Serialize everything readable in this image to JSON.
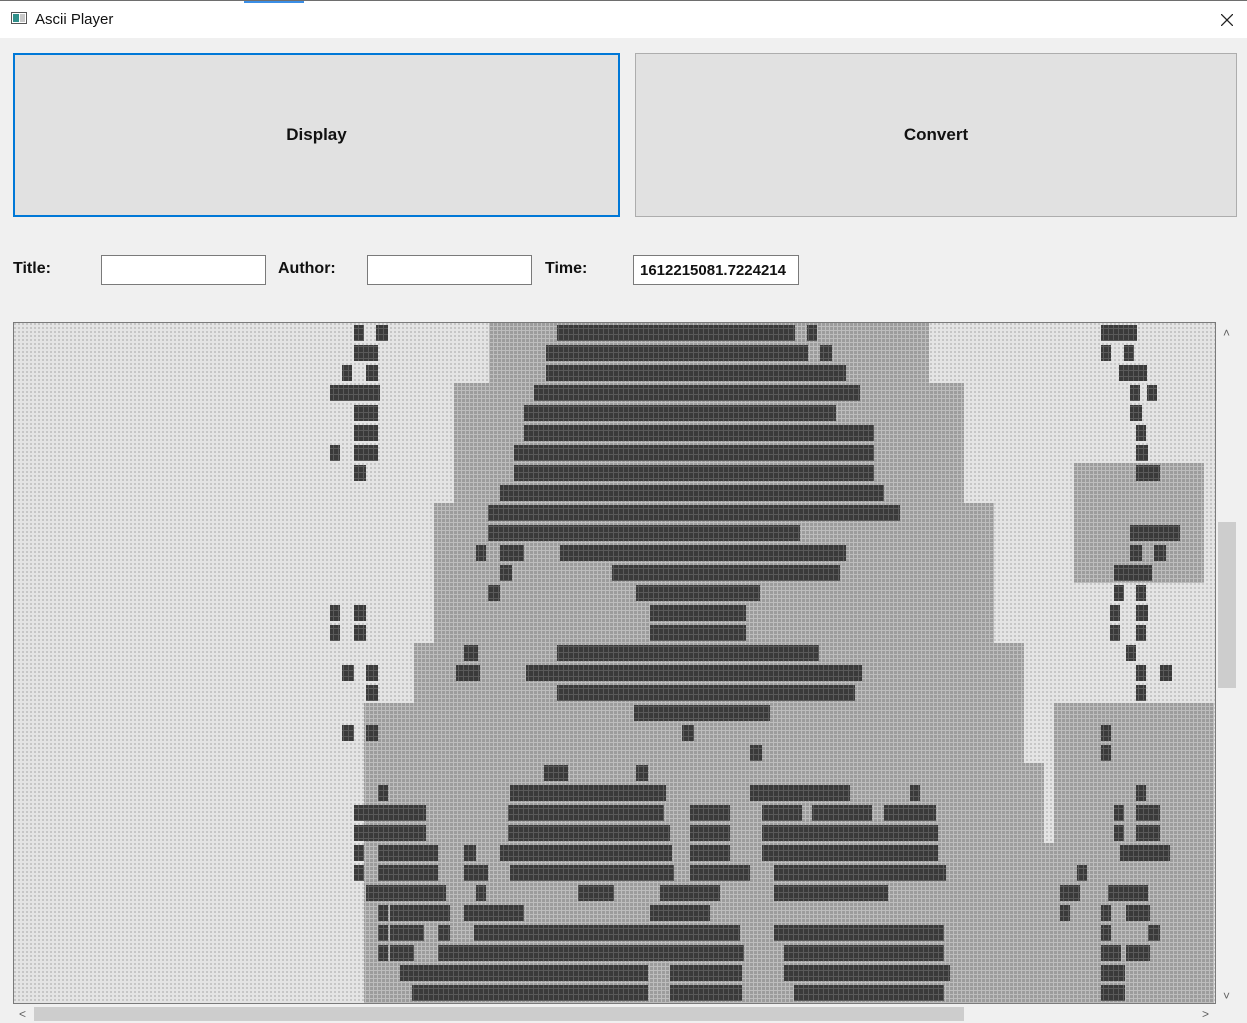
{
  "window": {
    "title": "Ascii Player",
    "close_label": "close"
  },
  "buttons": {
    "display_label": "Display",
    "convert_label": "Convert"
  },
  "fields": {
    "title_label": "Title:",
    "title_value": "",
    "author_label": "Author:",
    "author_value": "",
    "time_label": "Time:",
    "time_value": "1612215081.7224214"
  },
  "ascii_view": {
    "description": "ASCII-art rendered video frame",
    "colors": {
      "light": "#d2d2d2",
      "mid": "#a3a3a3",
      "dark": "#3f3f3f",
      "background": "#e6e6e6"
    }
  },
  "scrollbars": {
    "up_icon": "chevron-up-icon",
    "down_icon": "chevron-down-icon",
    "left_icon": "chevron-left-icon",
    "right_icon": "chevron-right-icon"
  }
}
